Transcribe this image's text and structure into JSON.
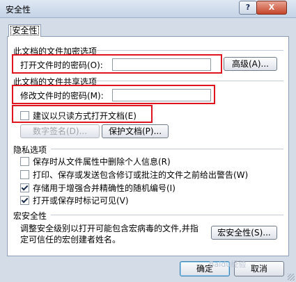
{
  "window": {
    "title": "安全性",
    "help_label": "?",
    "close_label": "X"
  },
  "tab": {
    "label": "安全性"
  },
  "encryption": {
    "section_label": "此文档的文件加密选项",
    "open_password_label": "打开文件时的密码(O):",
    "open_password_value": "",
    "advanced_label": "高级(A)..."
  },
  "sharing": {
    "section_label": "此文档的文件共享选项",
    "modify_password_label": "修改文件时的密码(M):",
    "modify_password_value": "",
    "readonly_label": "建议以只读方式打开文档(E)",
    "readonly_checked": false,
    "digital_signature_label": "数字签名(D)...",
    "protect_document_label": "保护文档(P)..."
  },
  "privacy": {
    "section_label": "隐私选项",
    "options": [
      {
        "label": "保存时从文件属性中删除个人信息(R)",
        "checked": false
      },
      {
        "label": "打印、保存或发送包含修订或批注的文件之前给出警告(W)",
        "checked": false
      },
      {
        "label": "存储用于增强合并精确性的随机编号(I)",
        "checked": true
      },
      {
        "label": "打开或保存时标记可见(V)",
        "checked": true
      }
    ]
  },
  "macro": {
    "section_label": "宏安全性",
    "description_line1": "调整安全级别以打开可能包含宏病毒的文件,并指",
    "description_line2": "定可信任的宏创建者姓名。",
    "button_label": "宏安全性(S)..."
  },
  "footer": {
    "ok_label": "确定",
    "cancel_label": "取消",
    "watermark": "Baidu经验"
  }
}
